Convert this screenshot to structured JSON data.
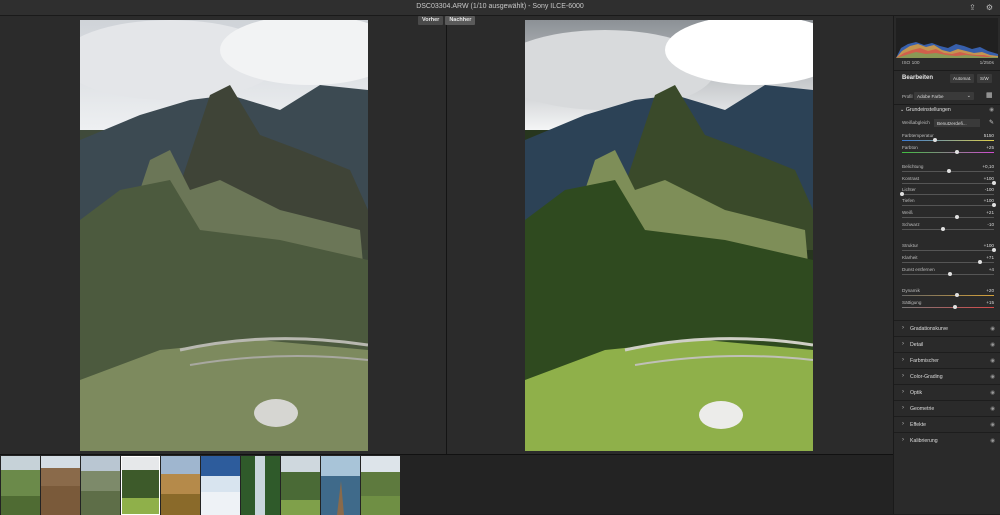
{
  "window": {
    "title": "DSC03304.ARW (1/10 ausgewählt) - Sony ILCE-6000"
  },
  "compare": {
    "before_label": "Vorher",
    "after_label": "Nachher"
  },
  "icons": {
    "export": "export-icon",
    "settings": "gear-icon",
    "eye": "eye-icon",
    "pipette": "eyedropper-icon",
    "grid": "profile-browser-icon"
  },
  "panel": {
    "iso": "ISO 100",
    "shutter": "1/250s",
    "edit_title": "Bearbeiten",
    "auto_label": "Automat.",
    "bw_label": "S/W",
    "profile_label": "Profil",
    "profile_value": "Adobe Farbe",
    "basic_title": "Grundeinstellungen",
    "wb_label": "Weißabgleich",
    "wb_value": "Benutzerdefi...",
    "sliders": [
      {
        "label": "Farbtemperatur",
        "value": "5150",
        "pos": 0.36
      },
      {
        "label": "Farbton",
        "value": "+25",
        "pos": 0.6
      },
      {
        "label": "Belichtung",
        "value": "+0,10",
        "pos": 0.51
      },
      {
        "label": "Kontrast",
        "value": "+100",
        "pos": 1.0
      },
      {
        "label": "Lichter",
        "value": "-100",
        "pos": 0.0
      },
      {
        "label": "Tiefen",
        "value": "+100",
        "pos": 1.0
      },
      {
        "label": "Weiß",
        "value": "+21",
        "pos": 0.6
      },
      {
        "label": "Schwarz",
        "value": "-10",
        "pos": 0.45
      },
      {
        "label": "Struktur",
        "value": "+100",
        "pos": 1.0
      },
      {
        "label": "Klarheit",
        "value": "+71",
        "pos": 0.85
      },
      {
        "label": "Dunst entfernen",
        "value": "+4",
        "pos": 0.52
      },
      {
        "label": "Dynamik",
        "value": "+20",
        "pos": 0.6
      },
      {
        "label": "Sättigung",
        "value": "+15",
        "pos": 0.58
      }
    ],
    "sections": [
      "Gradationskurve",
      "Detail",
      "Farbmischer",
      "Color-Grading",
      "Optik",
      "Geometrie",
      "Effekte",
      "Kalibrierung"
    ]
  },
  "filmstrip": {
    "count": 10,
    "selected_index": 3
  }
}
